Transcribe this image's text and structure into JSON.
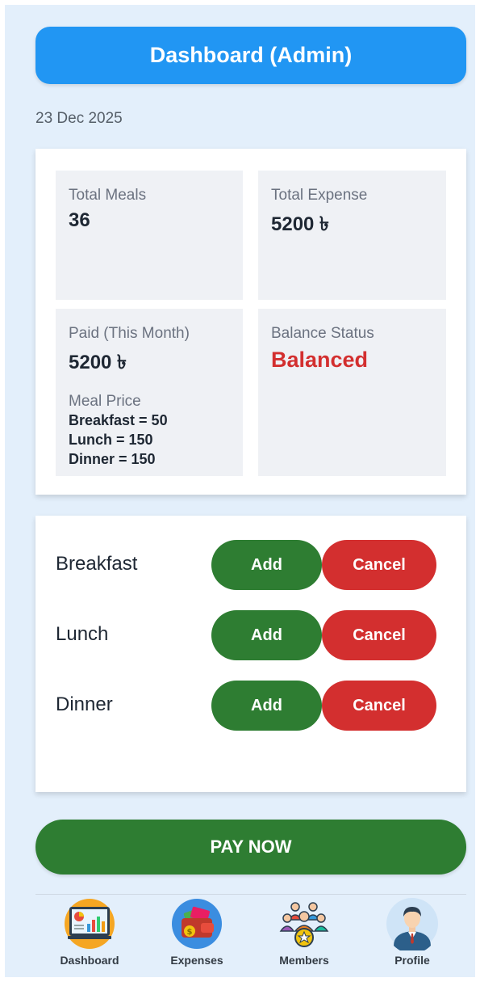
{
  "header": {
    "title": "Dashboard (Admin)"
  },
  "date": "23 Dec 2025",
  "stats": {
    "total_meals": {
      "label": "Total Meals",
      "value": "36"
    },
    "total_expense": {
      "label": "Total Expense",
      "value": "5200 ৳"
    },
    "paid": {
      "label": "Paid (This Month)",
      "value": "5200 ৳"
    },
    "balance": {
      "label": "Balance Status",
      "value": "Balanced"
    },
    "meal_price": {
      "label": "Meal Price",
      "lines": [
        "Breakfast = 50",
        "Lunch = 150",
        "Dinner = 150"
      ]
    }
  },
  "meals": [
    {
      "name": "Breakfast",
      "add_label": "Add",
      "cancel_label": "Cancel"
    },
    {
      "name": "Lunch",
      "add_label": "Add",
      "cancel_label": "Cancel"
    },
    {
      "name": "Dinner",
      "add_label": "Add",
      "cancel_label": "Cancel"
    }
  ],
  "pay_button": "PAY NOW",
  "nav": [
    {
      "label": "Dashboard",
      "icon": "dashboard-chart-icon"
    },
    {
      "label": "Expenses",
      "icon": "wallet-icon"
    },
    {
      "label": "Members",
      "icon": "members-group-icon"
    },
    {
      "label": "Profile",
      "icon": "profile-avatar-icon"
    }
  ],
  "colors": {
    "primary_blue": "#2196f3",
    "add_green": "#2e7d32",
    "cancel_red": "#d32f2f",
    "balanced_red": "#d32f2f",
    "background": "#e3effb"
  }
}
